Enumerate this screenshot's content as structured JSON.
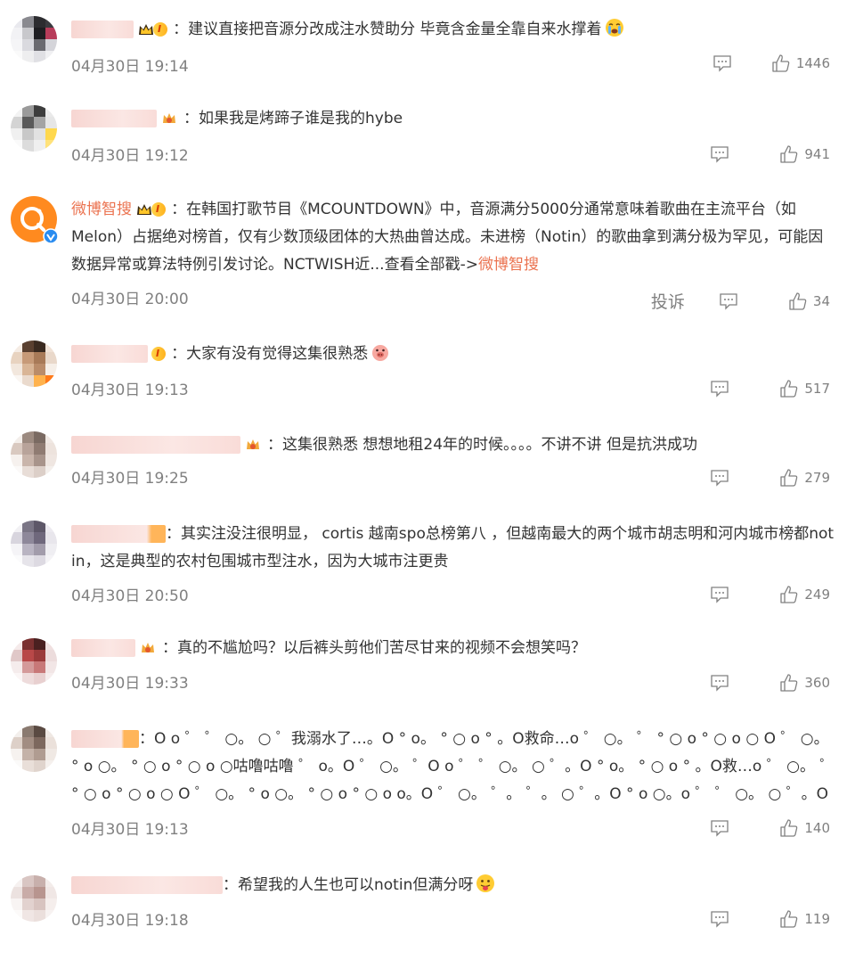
{
  "comments": [
    {
      "text": "建议直接把音源分改成注水赞助分 毕竟含金量全靠自来水撑着",
      "time": "04月30日 19:14",
      "likes": "1446",
      "badge": "I"
    },
    {
      "text": "如果我是烤蹄子谁是我的hybe",
      "time": "04月30日 19:12",
      "likes": "941"
    },
    {
      "username": "微博智搜",
      "badge": "I",
      "text": "在韩国打歌节目《MCOUNTDOWN》中，音源满分5000分通常意味着歌曲在主流平台（如Melon）占据绝对榜首，仅有少数顶级团体的大热曲曾达成。未进榜（Notin）的歌曲拿到满分极为罕见，可能因数据异常或算法特例引发讨论。NCTWISH近...查看全部戳->",
      "link": "微博智搜",
      "time": "04月30日 20:00",
      "report": "投诉",
      "likes": "34"
    },
    {
      "text": "大家有没有觉得这集很熟悉",
      "time": "04月30日 19:13",
      "likes": "517",
      "badge": "I"
    },
    {
      "text": "这集很熟悉 想想地租24年的时候。。。。不讲不讲 但是抗洪成功",
      "time": "04月30日 19:25",
      "likes": "279"
    },
    {
      "text": "其实注没注很明显， cortis 越南spo总榜第八 ，但越南最大的两个城市胡志明和河内城市榜都not in，这是典型的农村包围城市型注水，因为大城市注更贵",
      "time": "04月30日 20:50",
      "likes": "249"
    },
    {
      "text": "真的不尴尬吗？以后裤头剪他们苦尽甘来的视频不会想笑吗？",
      "time": "04月30日 19:33",
      "likes": "360"
    },
    {
      "text": "O o ゜ ゜ ○。 ○ ゜我溺水了…。O ° o。 ° ○ o ° 。O救命…o ゜ ○。 ゜ ° ○ o ° ○ o ○ O ゜ ○。 ° o ○。 ° ○ o ° ○ o ○咕噜咕噜 ゜ o。O ゜ ○。 ゜O o ゜ ゜ ○。 ○ ゜。O ° o。 ° ○ o ° 。O救…o ゜ ○。 ゜ ° ○ o ° ○ o ○ O ゜ ○。 ° o ○。 ° ○ o ° ○ o o。O ゜ ○。 ゜。 ゜。 ○ ゜。O ° o ○。o ゜ ゜ ○。 ○ ゜。O",
      "time": "04月30日 19:13",
      "likes": "140"
    },
    {
      "text": "希望我的人生也可以notin但满分呀",
      "time": "04月30日 19:18",
      "likes": "119"
    }
  ],
  "colors": {
    "accent": "#eb7350",
    "meta": "#808080",
    "text": "#333333"
  },
  "icons": {
    "reply": "comment-icon",
    "like": "thumbs-up-icon",
    "verified": "verified-badge-icon"
  }
}
